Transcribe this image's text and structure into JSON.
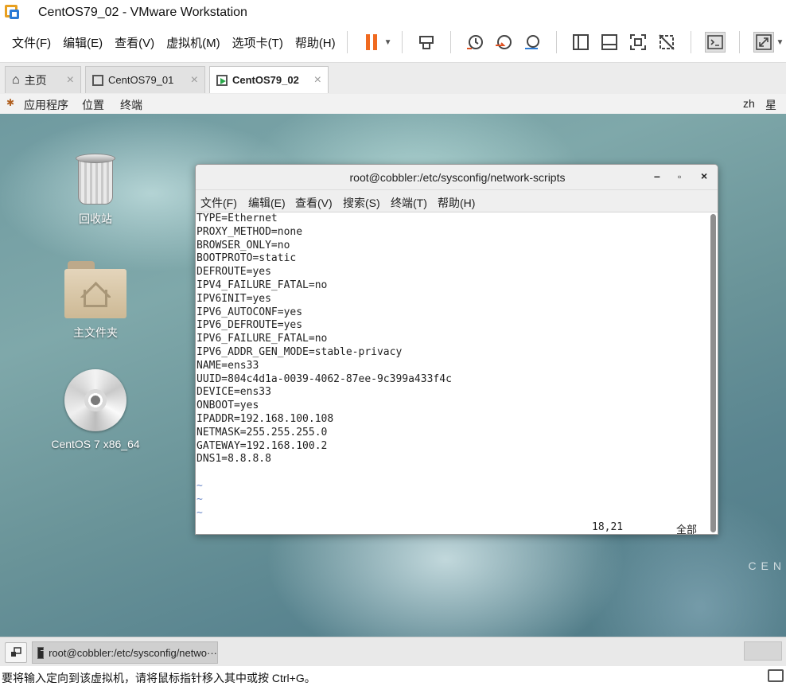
{
  "window": {
    "title": "CentOS79_02 - VMware Workstation"
  },
  "menubar": {
    "items": [
      "文件(F)",
      "编辑(E)",
      "查看(V)",
      "虚拟机(M)",
      "选项卡(T)",
      "帮助(H)"
    ]
  },
  "tabs": [
    {
      "label": "主页",
      "close": "×"
    },
    {
      "label": "CentOS79_01",
      "close": "×"
    },
    {
      "label": "CentOS79_02",
      "close": "×"
    }
  ],
  "gnome_bar": {
    "apps": "应用程序",
    "places": "位置",
    "terminal": "终端",
    "lang": "zh",
    "date": "星期"
  },
  "desktop": {
    "icons": [
      {
        "label": "回收站"
      },
      {
        "label": "主文件夹"
      },
      {
        "label": "CentOS 7 x86_64"
      }
    ],
    "watermark": "CEN"
  },
  "terminal": {
    "title": "root@cobbler:/etc/sysconfig/network-scripts",
    "controls": {
      "minimize": "–",
      "maximize": "▫",
      "close": "×"
    },
    "menu": [
      "文件(F)",
      "编辑(E)",
      "查看(V)",
      "搜索(S)",
      "终端(T)",
      "帮助(H)"
    ],
    "lines": [
      "TYPE=Ethernet",
      "PROXY_METHOD=none",
      "BROWSER_ONLY=no",
      "BOOTPROTO=static",
      "DEFROUTE=yes",
      "IPV4_FAILURE_FATAL=no",
      "IPV6INIT=yes",
      "IPV6_AUTOCONF=yes",
      "IPV6_DEFROUTE=yes",
      "IPV6_FAILURE_FATAL=no",
      "IPV6_ADDR_GEN_MODE=stable-privacy",
      "NAME=ens33",
      "UUID=804c4d1a-0039-4062-87ee-9c399a433f4c",
      "DEVICE=ens33",
      "ONBOOT=yes",
      "IPADDR=192.168.100.108",
      "NETMASK=255.255.255.0",
      "GATEWAY=192.168.100.2",
      "DNS1=8.8.8.8",
      ""
    ],
    "tildes": [
      "~",
      "~",
      "~"
    ],
    "cursor_pos": "18,21",
    "scope": "全部"
  },
  "taskbar": {
    "window_label": "root@cobbler:/etc/sysconfig/netwo···"
  },
  "statusbar": {
    "message": "要将输入定向到该虚拟机，请将鼠标指针移入其中或按 Ctrl+G。"
  }
}
